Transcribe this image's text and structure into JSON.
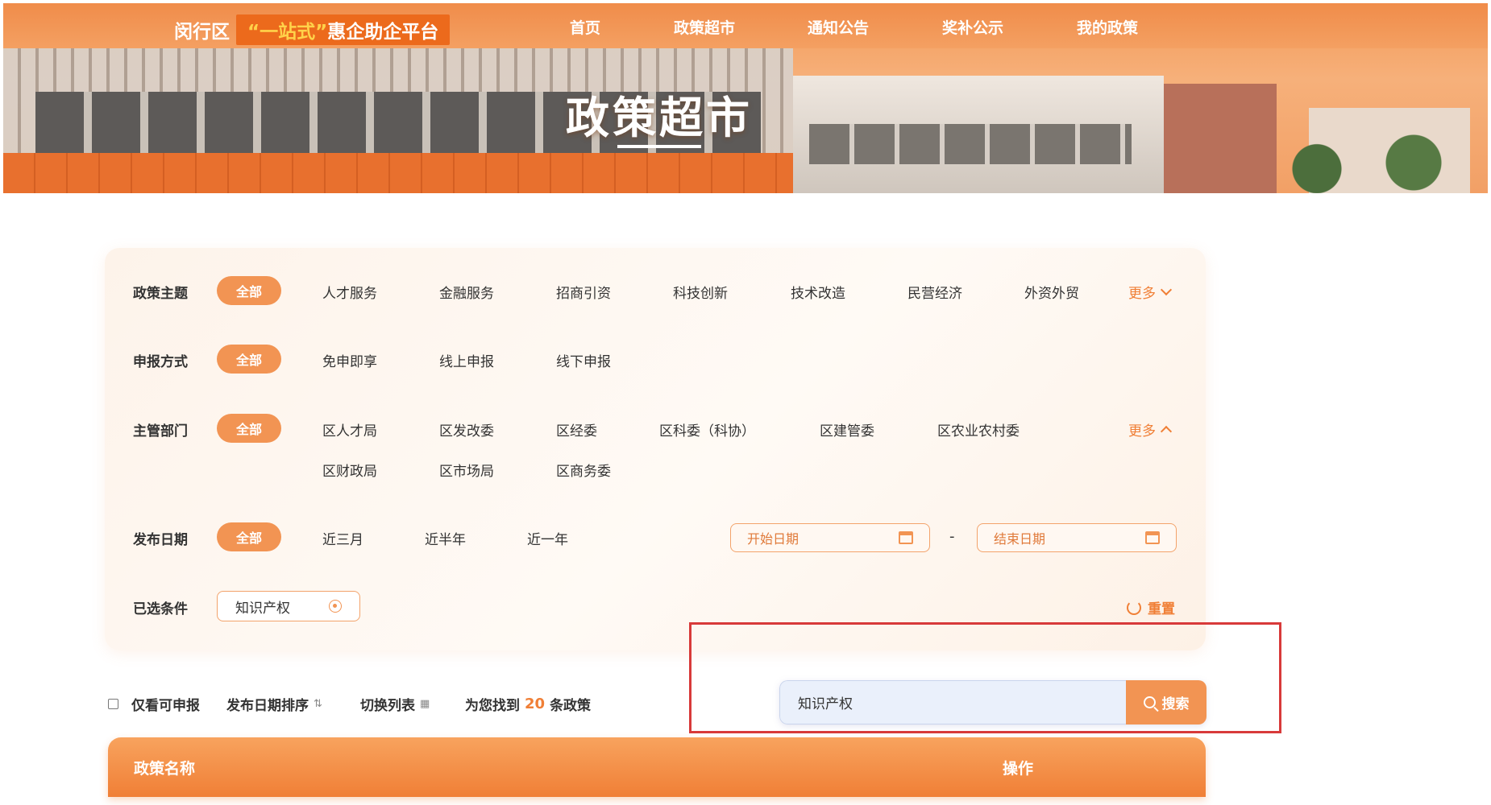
{
  "header": {
    "brand_district": "闵行区",
    "brand_slogan_quote": "“一站式”",
    "brand_slogan_rest": "惠企助企平台",
    "nav": [
      "首页",
      "政策超市",
      "通知公告",
      "奖补公示",
      "我的政策"
    ]
  },
  "banner": {
    "title": "政策超市"
  },
  "filters": {
    "theme": {
      "label": "政策主题",
      "all": "全部",
      "options": [
        "人才服务",
        "金融服务",
        "招商引资",
        "科技创新",
        "技术改造",
        "民营经济",
        "外资外贸"
      ],
      "more": "更多"
    },
    "method": {
      "label": "申报方式",
      "all": "全部",
      "options": [
        "免申即享",
        "线上申报",
        "线下申报"
      ]
    },
    "department": {
      "label": "主管部门",
      "all": "全部",
      "options_row1": [
        "区人才局",
        "区发改委",
        "区经委",
        "区科委（科协）",
        "区建管委",
        "区农业农村委"
      ],
      "options_row2": [
        "区财政局",
        "区市场局",
        "区商务委"
      ],
      "more": "更多"
    },
    "date": {
      "label": "发布日期",
      "all": "全部",
      "options": [
        "近三月",
        "近半年",
        "近一年"
      ],
      "start_placeholder": "开始日期",
      "separator": "-",
      "end_placeholder": "结束日期"
    },
    "selected": {
      "label": "已选条件",
      "chip": "知识产权",
      "reset": "重置"
    }
  },
  "toolbar": {
    "only_applicable": "仅看可申报",
    "sort_by_date": "发布日期排序",
    "switch_list": "切换列表",
    "found_prefix": "为您找到",
    "found_count": "20",
    "found_suffix": "条政策"
  },
  "search": {
    "value": "知识产权",
    "button": "搜索"
  },
  "table": {
    "col_name": "政策名称",
    "col_action": "操作"
  },
  "colors": {
    "accent": "#f29453",
    "accent_dark": "#f07f36",
    "highlight": "#d83a3a"
  }
}
